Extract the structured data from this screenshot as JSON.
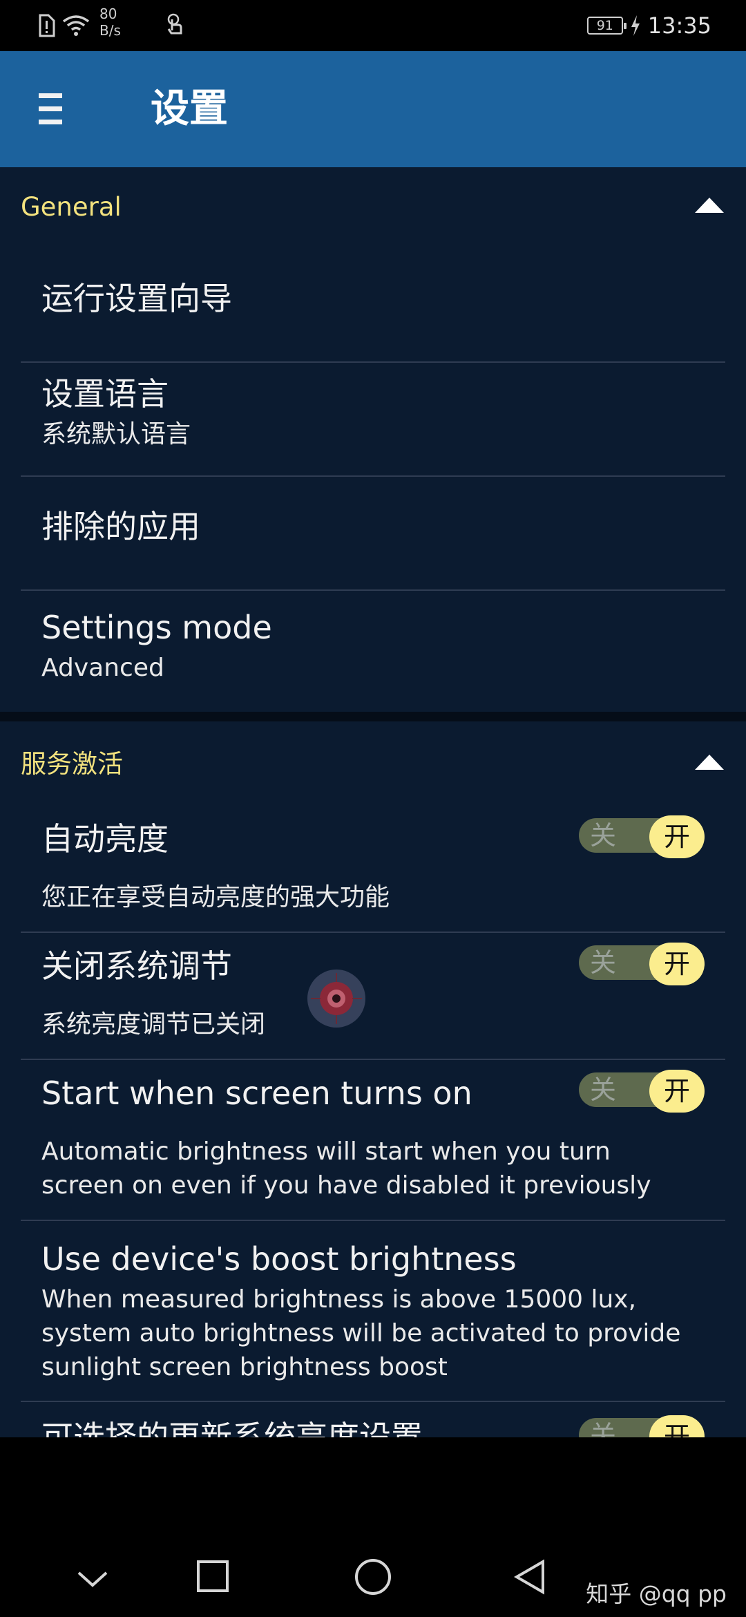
{
  "status_bar": {
    "net_speed_value": "80",
    "net_speed_unit": "B/s",
    "battery": "91",
    "time": "13:35"
  },
  "app_bar": {
    "title": "设置",
    "menu_icon": "hamburger-menu-icon"
  },
  "general_section": {
    "title": "General",
    "items": [
      {
        "title": "运行设置向导"
      },
      {
        "title": "设置语言",
        "subtitle": "系统默认语言"
      },
      {
        "title": "排除的应用"
      },
      {
        "title": "Settings mode",
        "subtitle": "Advanced"
      }
    ]
  },
  "service_section": {
    "title": "服务激活",
    "items": [
      {
        "title": "自动亮度",
        "subtitle": "您正在享受自动亮度的强大功能",
        "toggle_on": true
      },
      {
        "title": "关闭系统调节",
        "subtitle": "系统亮度调节已关闭",
        "toggle_on": true
      },
      {
        "title": "Start when screen turns on",
        "subtitle_line1": "Automatic brightness will start when you turn",
        "subtitle_line2": "screen on even if you have disabled it previously",
        "toggle_on": true
      },
      {
        "title": "Use device's boost brightness",
        "subtitle_line1": "When measured brightness is above 15000 lux,",
        "subtitle_line2": "system auto brightness will be activated to provide",
        "subtitle_line3": "sunlight screen brightness boost"
      },
      {
        "title": "可选择的更新系统亮度设置",
        "toggle_on": true
      }
    ]
  },
  "toggle_labels": {
    "off": "关",
    "on": "开"
  },
  "nav_bar": {
    "watermark": "知乎 @qq pp"
  },
  "colors": {
    "app_bar": "#1c629d",
    "background": "#0b1b30",
    "section_title": "#f3e27e",
    "toggle_knob": "#fbed8e"
  }
}
